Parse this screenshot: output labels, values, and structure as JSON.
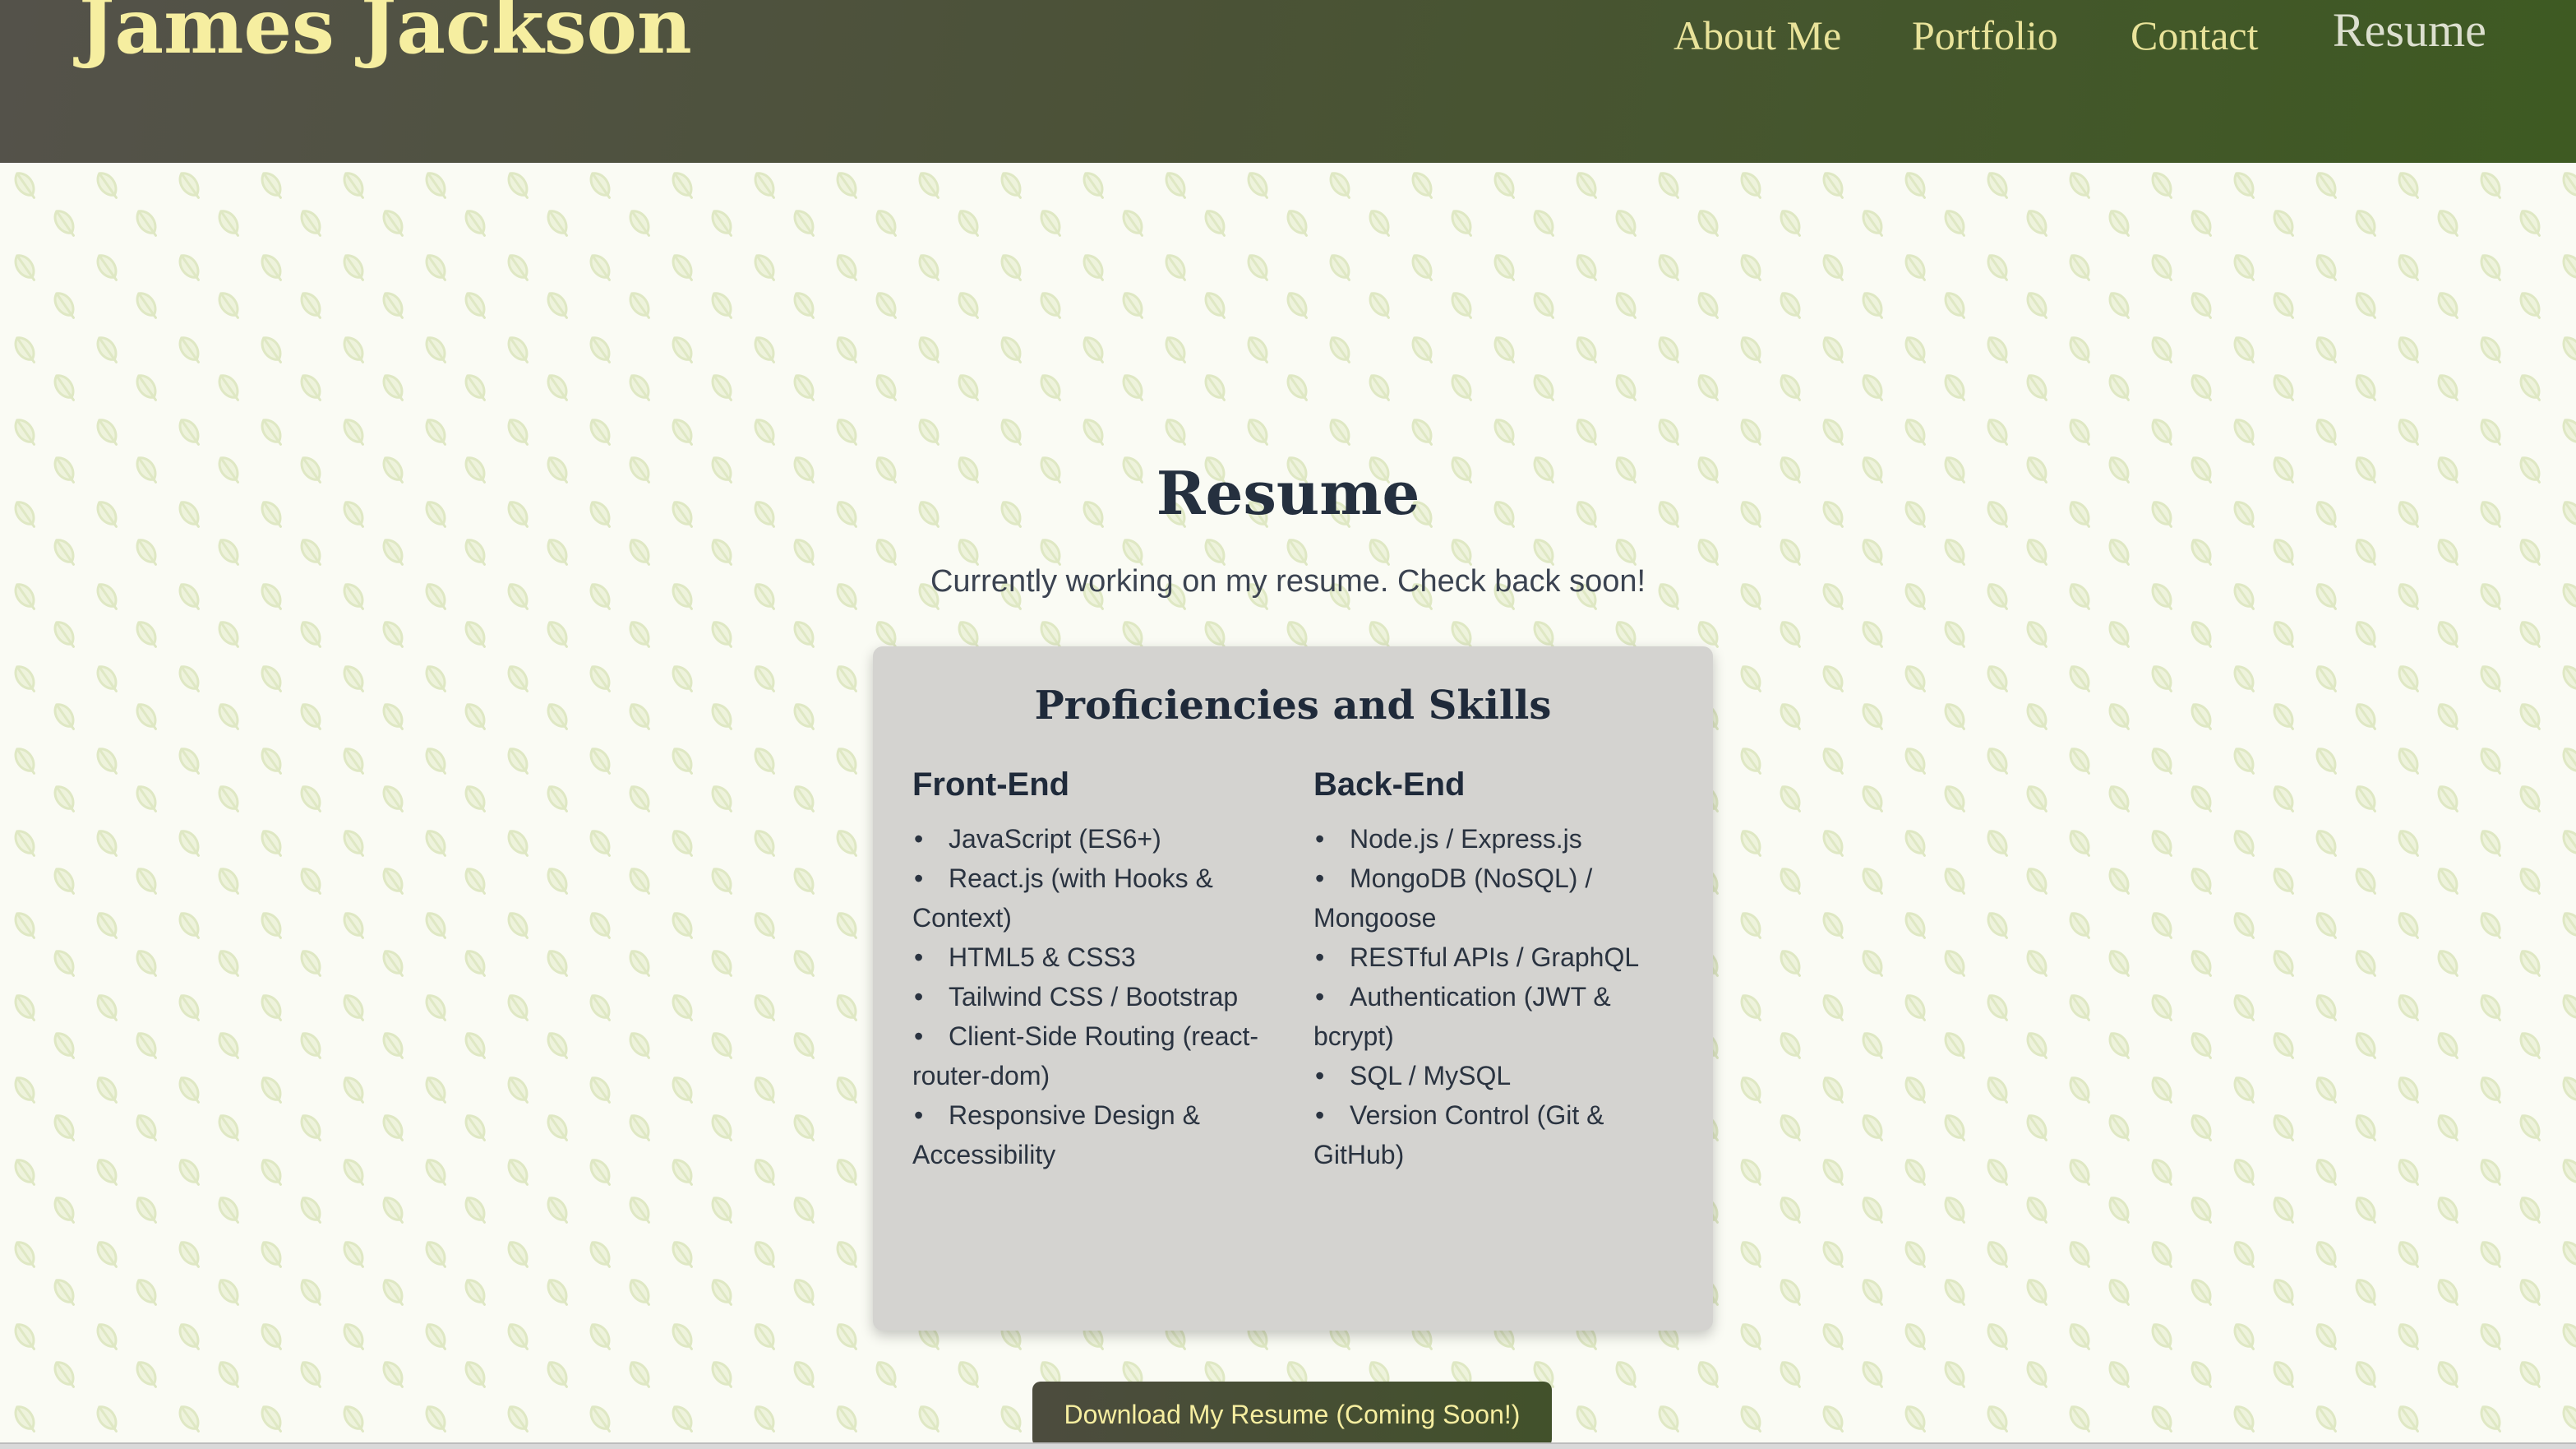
{
  "header": {
    "site_name": "James Jackson",
    "nav": [
      {
        "label": "About Me",
        "active": false
      },
      {
        "label": "Portfolio",
        "active": false
      },
      {
        "label": "Contact",
        "active": false
      },
      {
        "label": "Resume",
        "active": true
      }
    ]
  },
  "main": {
    "title": "Resume",
    "subtitle": "Currently working on my resume. Check back soon!",
    "skills_card": {
      "title": "Proficiencies and Skills",
      "front_end": {
        "heading": "Front-End",
        "items": [
          "JavaScript (ES6+)",
          "React.js (with Hooks & Context)",
          "HTML5 & CSS3",
          "Tailwind CSS / Bootstrap",
          "Client-Side Routing (react-router-dom)",
          "Responsive Design & Accessibility"
        ]
      },
      "back_end": {
        "heading": "Back-End",
        "items": [
          "Node.js / Express.js",
          "MongoDB (NoSQL) / Mongoose",
          "RESTful APIs / GraphQL",
          "Authentication (JWT & bcrypt)",
          "SQL / MySQL",
          "Version Control (Git & GitHub)"
        ]
      },
      "download_button_label": "Download My Resume (Coming Soon!)"
    }
  },
  "background": {
    "pattern_icon": "leaf-icon"
  },
  "colors": {
    "header_gradient_start": "#54524a",
    "header_gradient_end": "#3e5a22",
    "accent_text": "#f6eea0",
    "card_background": "#d4d3d0",
    "leaf_pattern": "#dfe8c4",
    "title_text": "#25303f"
  }
}
